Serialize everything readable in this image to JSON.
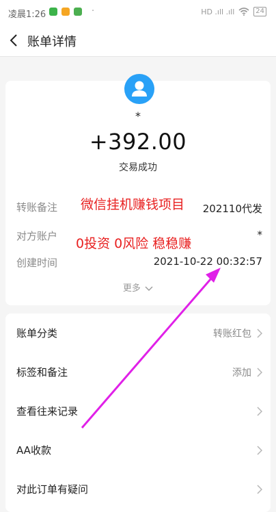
{
  "status_bar": {
    "time": "凌晨1:26",
    "dot": "·",
    "signal": "HD .ıll .ıll",
    "battery": "24"
  },
  "header": {
    "title": "账单详情"
  },
  "summary": {
    "payee_name": "*",
    "amount": "+392.00",
    "status": "交易成功",
    "details": [
      {
        "label": "转账备注",
        "value": "202110代发"
      },
      {
        "label": "对方账户",
        "value": "*"
      },
      {
        "label": "创建时间",
        "value": "2021-10-22 00:32:57"
      }
    ],
    "more_label": "更多"
  },
  "overlay_text": {
    "line1": "微信挂机赚钱项目",
    "line2": "0投资 0风险 稳稳赚"
  },
  "list": [
    {
      "label": "账单分类",
      "value": "转账红包"
    },
    {
      "label": "标签和备注",
      "value": "添加"
    },
    {
      "label": "查看往来记录",
      "value": ""
    },
    {
      "label": "AA收款",
      "value": ""
    },
    {
      "label": "对此订单有疑问",
      "value": ""
    }
  ],
  "colors": {
    "accent_blue": "#29a1f7",
    "overlay_red": "#e82020",
    "arrow_magenta": "#e020e8"
  }
}
